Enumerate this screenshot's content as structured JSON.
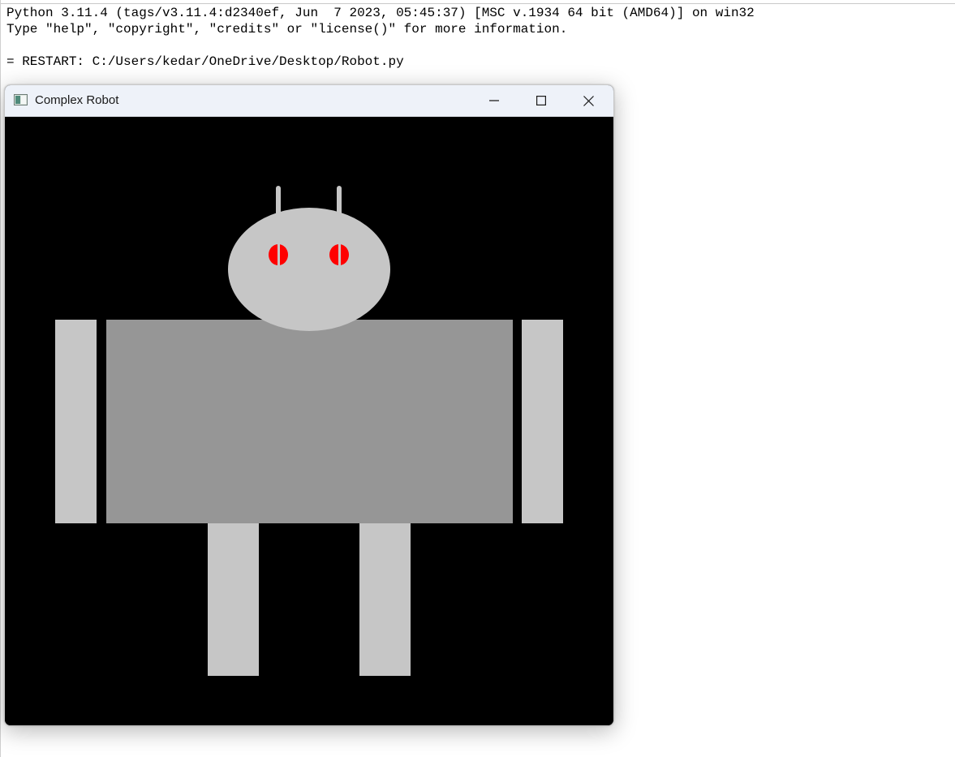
{
  "shell": {
    "line1": "Python 3.11.4 (tags/v3.11.4:d2340ef, Jun  7 2023, 05:45:37) [MSC v.1934 64 bit (AMD64)] on win32",
    "line2": "Type \"help\", \"copyright\", \"credits\" or \"license()\" for more information.",
    "line3": "= RESTART: C:/Users/kedar/OneDrive/Desktop/Robot.py"
  },
  "window": {
    "title": "Complex Robot",
    "icons": [
      "app-icon",
      "minimize-icon",
      "maximize-icon",
      "close-icon"
    ]
  },
  "robot": {
    "background_color": "#000000",
    "head_color": "#c6c6c6",
    "antenna_color": "#c6c6c6",
    "eye_color": "#ff0000",
    "body_color": "#969696",
    "arm_color": "#c6c6c6",
    "leg_color": "#c6c6c6"
  }
}
